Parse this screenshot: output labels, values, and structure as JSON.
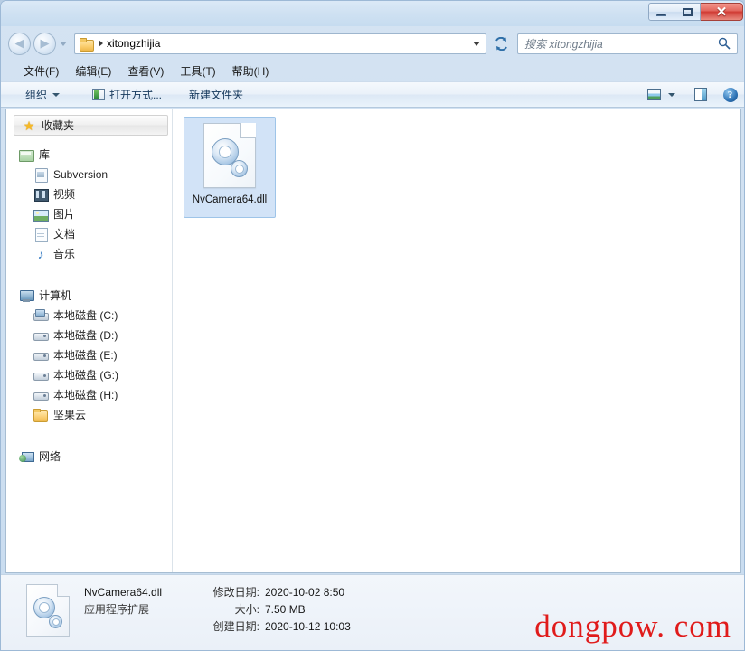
{
  "window": {
    "controls": {
      "minimize_label": "–",
      "maximize_label": "",
      "close_label": "✕"
    }
  },
  "address_bar": {
    "back_label": "◀",
    "forward_label": "▶",
    "path": "xitongzhijia",
    "refresh_label": "↻"
  },
  "search": {
    "placeholder": "搜索 xitongzhijia",
    "icon_label": "⌕"
  },
  "menu": {
    "items": [
      {
        "label": "文件(F)"
      },
      {
        "label": "编辑(E)"
      },
      {
        "label": "查看(V)"
      },
      {
        "label": "工具(T)"
      },
      {
        "label": "帮助(H)"
      }
    ]
  },
  "toolbar": {
    "organize_label": "组织",
    "open_with_label": "打开方式...",
    "new_folder_label": "新建文件夹",
    "help_label": "?"
  },
  "sidebar": {
    "favorites": {
      "label": "收藏夹"
    },
    "library": {
      "label": "库"
    },
    "library_items": [
      {
        "label": "Subversion"
      },
      {
        "label": "视频"
      },
      {
        "label": "图片"
      },
      {
        "label": "文档"
      },
      {
        "label": "音乐"
      }
    ],
    "computer": {
      "label": "计算机"
    },
    "computer_items": [
      {
        "label": "本地磁盘 (C:)"
      },
      {
        "label": "本地磁盘 (D:)"
      },
      {
        "label": "本地磁盘 (E:)"
      },
      {
        "label": "本地磁盘 (G:)"
      },
      {
        "label": "本地磁盘 (H:)"
      },
      {
        "label": "坚果云"
      }
    ],
    "network": {
      "label": "网络"
    }
  },
  "files": [
    {
      "name": "NvCamera64.dll"
    }
  ],
  "details": {
    "name": "NvCamera64.dll",
    "type": "应用程序扩展",
    "modified_key": "修改日期:",
    "modified_value": "2020-10-02 8:50",
    "size_key": "大小:",
    "size_value": "7.50 MB",
    "created_key": "创建日期:",
    "created_value": "2020-10-12 10:03"
  },
  "watermark": {
    "text": "dongpow. com",
    "color": "#e01b1b"
  }
}
